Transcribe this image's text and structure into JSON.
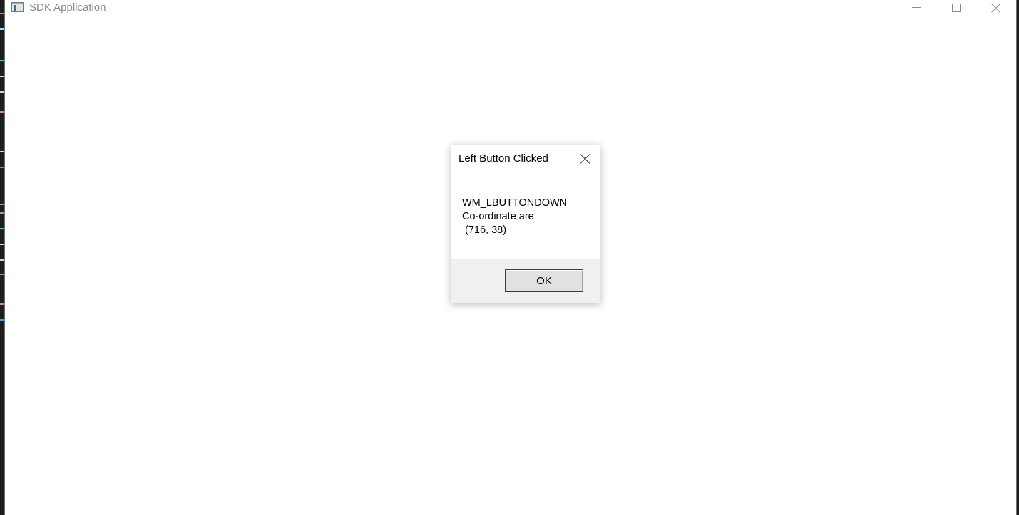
{
  "app": {
    "title": "SDK Application",
    "icon": "app-window-icon"
  },
  "caption_buttons": {
    "minimize_icon": "minimize-icon",
    "maximize_icon": "maximize-icon",
    "close_icon": "close-icon"
  },
  "dialog": {
    "title": "Left Button Clicked",
    "message_line1": "WM_LBUTTONDOWN",
    "message_line2": "Co-ordinate are",
    "message_line3": " (716, 38)",
    "ok_label": "OK",
    "close_icon": "close-icon"
  },
  "colors": {
    "window_bg": "#ffffff",
    "dialog_footer": "#f0f0f0",
    "title_text_inactive": "#8a8a8a",
    "background_editor": "#1e1e1e"
  }
}
